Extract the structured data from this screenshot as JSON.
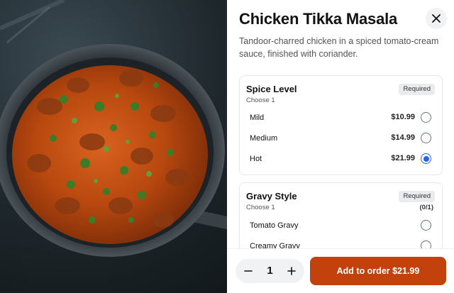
{
  "dish": {
    "title": "Chicken Tikka Masala",
    "description": "Tandoor-charred chicken in a spiced tomato-cream sauce, finished with coriander.",
    "image_alt_icon": "food-photo"
  },
  "close": {
    "icon": "close-icon"
  },
  "option_groups": [
    {
      "title": "Spice Level",
      "subtitle": "Choose 1",
      "badge": "Required",
      "options": [
        {
          "label": "Mild",
          "price": "$10.99",
          "selected": false
        },
        {
          "label": "Medium",
          "price": "$14.99",
          "selected": false
        },
        {
          "label": "Hot",
          "price": "$21.99",
          "selected": true
        }
      ]
    },
    {
      "title": "Gravy Style",
      "subtitle": "Choose 1",
      "badge": "Required",
      "count": "(0/1)",
      "options": [
        {
          "label": "Tomato Gravy",
          "selected": false
        },
        {
          "label": "Creamy Gravy",
          "selected": false
        }
      ]
    }
  ],
  "footer": {
    "quantity": "1",
    "minus_icon": "minus-icon",
    "plus_icon": "plus-icon",
    "add_label": "Add to order $21.99"
  },
  "colors": {
    "accent": "#c2410c",
    "radio_selected": "#2563eb"
  }
}
